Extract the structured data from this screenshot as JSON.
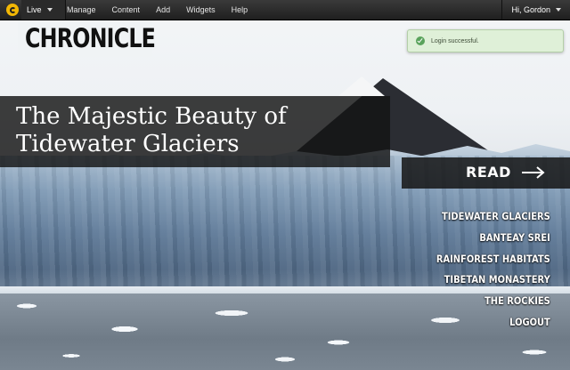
{
  "adminbar": {
    "logo_icon": "gear-c-logo-icon",
    "live_label": "Live",
    "menu": [
      "Manage",
      "Content",
      "Add",
      "Widgets",
      "Help"
    ],
    "user_label": "Hi, Gordon"
  },
  "site": {
    "title": "CHRONICLE"
  },
  "toast": {
    "icon": "check-circle-icon",
    "message": "Login successful.",
    "color": "#dff0d8"
  },
  "hero": {
    "headline": "The Majestic Beauty of Tidewater Glaciers",
    "read_label": "READ",
    "read_icon": "arrow-right-icon"
  },
  "nav": {
    "items": [
      "TIDEWATER GLACIERS",
      "BANTEAY SREI",
      "RAINFOREST HABITATS",
      "TIBETAN MONASTERY",
      "THE ROCKIES",
      "LOGOUT"
    ]
  }
}
